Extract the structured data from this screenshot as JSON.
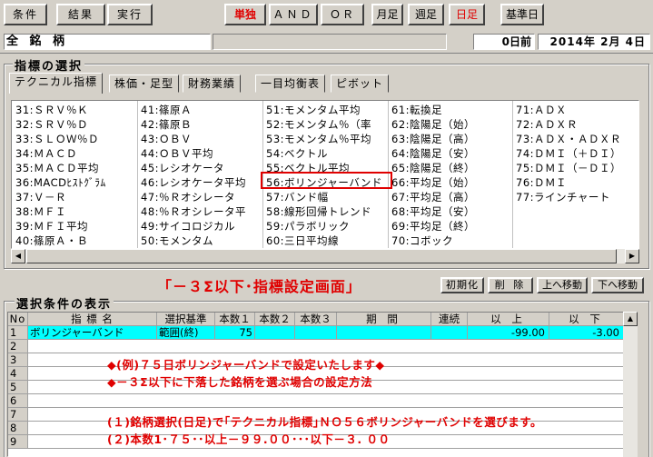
{
  "toolbar": {
    "jouken": "条件",
    "kekka": "結果",
    "jikkou": "実行",
    "tandoku": "単独",
    "and": "ＡＮＤ",
    "or": "ＯＲ",
    "getsuashi": "月足",
    "shuashi": "週足",
    "nichiashi": "日足",
    "kijunbi": "基準日"
  },
  "stockbar": {
    "name": "全 銘 柄",
    "days_ago": "0日前",
    "date": "2014年 2月 4日"
  },
  "indicator_section": {
    "title": "指標の選択",
    "tabs": [
      "テクニカル指標",
      "株価・足型",
      "財務業績",
      "一目均衡表",
      "ピボット"
    ],
    "active_tab": 0,
    "columns": [
      [
        "31:ＳＲＶ％Ｋ",
        "32:ＳＲＶ％Ｄ",
        "33:ＳＬＯＷ％Ｄ",
        "34:ＭＡＣＤ",
        "35:ＭＡＣＤ平均",
        "36:MACDﾋｽﾄｸﾞﾗﾑ",
        "37:Ｖ－Ｒ",
        "38:ＭＦＩ",
        "39:ＭＦＩ平均",
        "40:篠原Ａ・Ｂ"
      ],
      [
        "41:篠原Ａ",
        "42:篠原Ｂ",
        "43:ＯＢＶ",
        "44:ＯＢＶ平均",
        "45:レシオケータ",
        "46:レシオケータ平均",
        "47:％Ｒオシレータ",
        "48:％Ｒオシレータ平",
        "49:サイコロジカル",
        "50:モメンタム"
      ],
      [
        "51:モメンタム平均",
        "52:モメンタム％（率",
        "53:モメンタム％平均",
        "54:ベクトル",
        "55:ベクトル平均",
        "56:ボリンジャーバンド",
        "57:バンド幅",
        "58:線形回帰トレンド",
        "59:パラボリック",
        "60:三日平均線"
      ],
      [
        "61:転換足",
        "62:陰陽足（始）",
        "63:陰陽足（高）",
        "64:陰陽足（安）",
        "65:陰陽足（終）",
        "66:平均足（始）",
        "67:平均足（高）",
        "68:平均足（安）",
        "69:平均足（終）",
        "70:コボック"
      ],
      [
        "71:ＡＤＸ",
        "72:ＡＤＸＲ",
        "73:ＡＤＸ・ＡＤＸＲ",
        "74:ＤＭＩ（＋ＤＩ）",
        "75:ＤＭＩ（－ＤＩ）",
        "76:ＤＭＩ",
        "77:ラインチャート",
        "",
        "",
        ""
      ]
    ]
  },
  "caption": "「－３Σ以下･指標設定画面」",
  "actions": {
    "init": "初期化",
    "delete": "削 除",
    "up": "上へ移動",
    "down": "下へ移動"
  },
  "conditions": {
    "title": "選択条件の表示",
    "headers": [
      "No",
      "指 標 名",
      "選択基準",
      "本数１",
      "本数２",
      "本数３",
      "期 間",
      "連続",
      "以 上",
      "以 下"
    ],
    "rows": [
      {
        "no": "1",
        "name": "ボリンジャーバンド",
        "basis": "範囲(終)",
        "n1": "75",
        "n2": "",
        "n3": "",
        "period": "",
        "renzoku": "",
        "ijou": "-99.00",
        "ika": "-3.00"
      },
      {
        "no": "2"
      },
      {
        "no": "3"
      },
      {
        "no": "4"
      },
      {
        "no": "5"
      },
      {
        "no": "6"
      },
      {
        "no": "7"
      },
      {
        "no": "8"
      },
      {
        "no": "9"
      }
    ]
  },
  "notes": {
    "line1": "◆(例)７５日ボリンジャーバンドで設定いたします◆",
    "line2": "◆－３Σ以下に下落した銘柄を選ぶ場合の設定方法",
    "line3": "(１)銘柄選択(日足)で｢テクニカル指標｣ＮＯ５６ボリンジャーバンドを選びます。",
    "line4": "(２)本数1･７５･･以上－９９.００･･･以下－３. ００"
  }
}
